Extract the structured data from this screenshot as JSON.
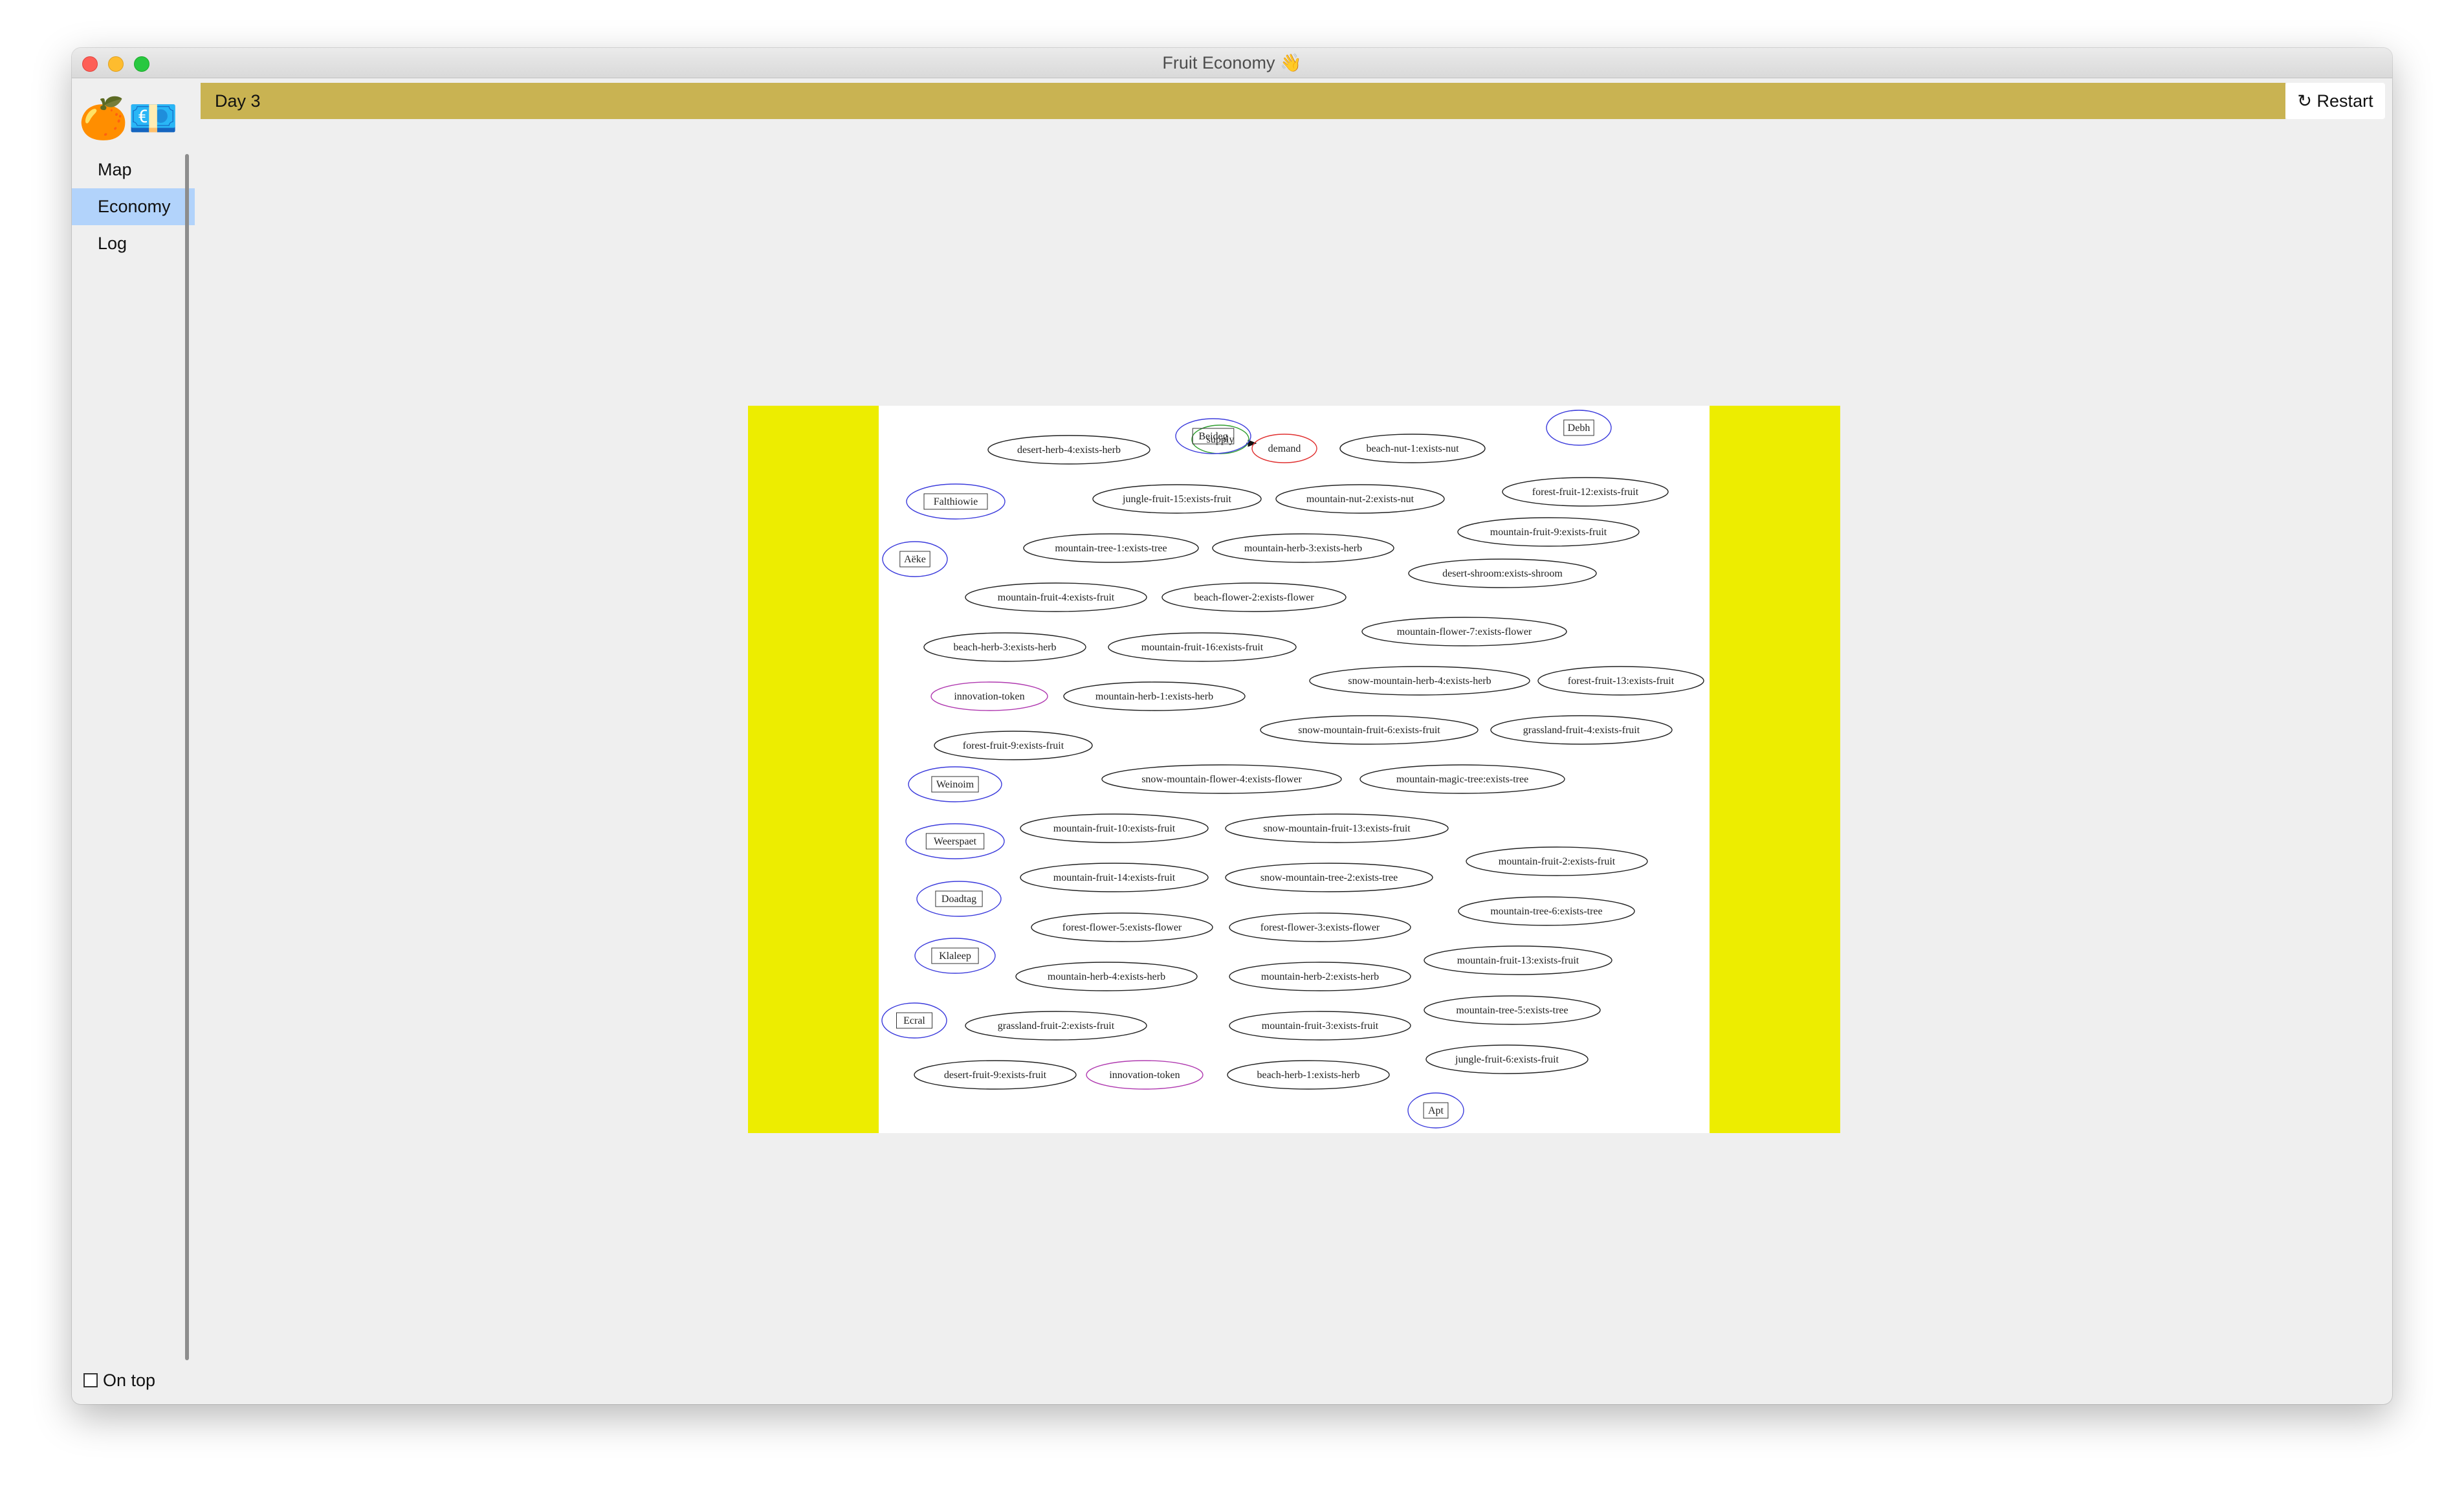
{
  "window": {
    "title": "Fruit Economy 👋"
  },
  "logo": {
    "emoji": "🍊💶"
  },
  "sidebar": {
    "items": [
      {
        "label": "Map",
        "active": false
      },
      {
        "label": "Economy",
        "active": true
      },
      {
        "label": "Log",
        "active": false
      }
    ],
    "on_top_label": "On top",
    "on_top_checked": false
  },
  "header": {
    "day_label": "Day 3",
    "day_bar_color": "#c9b352"
  },
  "toolbar": {
    "restart_label": "↻ Restart"
  },
  "graph": {
    "background": "#eded00",
    "nodes": [
      {
        "label": "supply",
        "kind": "supply",
        "color": "#2e9e2e"
      },
      {
        "label": "demand",
        "kind": "demand",
        "color": "#e03030"
      },
      {
        "label": "desert-herb-4:exists-herb",
        "kind": "resource"
      },
      {
        "label": "Beideg",
        "kind": "agent",
        "color": "#3c3cdc"
      },
      {
        "label": "beach-nut-1:exists-nut",
        "kind": "resource"
      },
      {
        "label": "Debh",
        "kind": "agent",
        "color": "#3c3cdc"
      },
      {
        "label": "Falthiowie",
        "kind": "agent",
        "color": "#3c3cdc"
      },
      {
        "label": "jungle-fruit-15:exists-fruit",
        "kind": "resource"
      },
      {
        "label": "mountain-nut-2:exists-nut",
        "kind": "resource"
      },
      {
        "label": "forest-fruit-12:exists-fruit",
        "kind": "resource"
      },
      {
        "label": "Aëke",
        "kind": "agent",
        "color": "#3c3cdc"
      },
      {
        "label": "mountain-tree-1:exists-tree",
        "kind": "resource"
      },
      {
        "label": "mountain-herb-3:exists-herb",
        "kind": "resource"
      },
      {
        "label": "mountain-fruit-9:exists-fruit",
        "kind": "resource"
      },
      {
        "label": "mountain-fruit-4:exists-fruit",
        "kind": "resource"
      },
      {
        "label": "beach-flower-2:exists-flower",
        "kind": "resource"
      },
      {
        "label": "desert-shroom:exists-shroom",
        "kind": "resource"
      },
      {
        "label": "beach-herb-3:exists-herb",
        "kind": "resource"
      },
      {
        "label": "mountain-fruit-16:exists-fruit",
        "kind": "resource"
      },
      {
        "label": "mountain-flower-7:exists-flower",
        "kind": "resource"
      },
      {
        "label": "innovation-token",
        "kind": "token",
        "color": "#b03ab0"
      },
      {
        "label": "mountain-herb-1:exists-herb",
        "kind": "resource"
      },
      {
        "label": "snow-mountain-herb-4:exists-herb",
        "kind": "resource"
      },
      {
        "label": "forest-fruit-13:exists-fruit",
        "kind": "resource"
      },
      {
        "label": "forest-fruit-9:exists-fruit",
        "kind": "resource"
      },
      {
        "label": "snow-mountain-fruit-6:exists-fruit",
        "kind": "resource"
      },
      {
        "label": "grassland-fruit-4:exists-fruit",
        "kind": "resource"
      },
      {
        "label": "Weinoim",
        "kind": "agent",
        "color": "#3c3cdc"
      },
      {
        "label": "snow-mountain-flower-4:exists-flower",
        "kind": "resource"
      },
      {
        "label": "mountain-magic-tree:exists-tree",
        "kind": "resource"
      },
      {
        "label": "Weerspaet",
        "kind": "agent",
        "color": "#3c3cdc"
      },
      {
        "label": "mountain-fruit-10:exists-fruit",
        "kind": "resource"
      },
      {
        "label": "snow-mountain-fruit-13:exists-fruit",
        "kind": "resource"
      },
      {
        "label": "mountain-fruit-2:exists-fruit",
        "kind": "resource"
      },
      {
        "label": "Doadtag",
        "kind": "agent",
        "color": "#3c3cdc"
      },
      {
        "label": "mountain-fruit-14:exists-fruit",
        "kind": "resource"
      },
      {
        "label": "snow-mountain-tree-2:exists-tree",
        "kind": "resource"
      },
      {
        "label": "mountain-tree-6:exists-tree",
        "kind": "resource"
      },
      {
        "label": "Klaleep",
        "kind": "agent",
        "color": "#3c3cdc"
      },
      {
        "label": "forest-flower-5:exists-flower",
        "kind": "resource"
      },
      {
        "label": "forest-flower-3:exists-flower",
        "kind": "resource"
      },
      {
        "label": "mountain-fruit-13:exists-fruit",
        "kind": "resource"
      },
      {
        "label": "mountain-herb-4:exists-herb",
        "kind": "resource"
      },
      {
        "label": "mountain-herb-2:exists-herb",
        "kind": "resource"
      },
      {
        "label": "mountain-tree-5:exists-tree",
        "kind": "resource"
      },
      {
        "label": "Ecral",
        "kind": "agent",
        "color": "#3c3cdc"
      },
      {
        "label": "grassland-fruit-2:exists-fruit",
        "kind": "resource"
      },
      {
        "label": "mountain-fruit-3:exists-fruit",
        "kind": "resource"
      },
      {
        "label": "jungle-fruit-6:exists-fruit",
        "kind": "resource"
      },
      {
        "label": "desert-fruit-9:exists-fruit",
        "kind": "resource"
      },
      {
        "label": "innovation-token",
        "kind": "token",
        "color": "#b03ab0"
      },
      {
        "label": "beach-herb-1:exists-herb",
        "kind": "resource"
      },
      {
        "label": "Apt",
        "kind": "agent",
        "color": "#3c3cdc"
      }
    ],
    "edges": [
      {
        "from": "supply",
        "to": "demand"
      }
    ]
  }
}
